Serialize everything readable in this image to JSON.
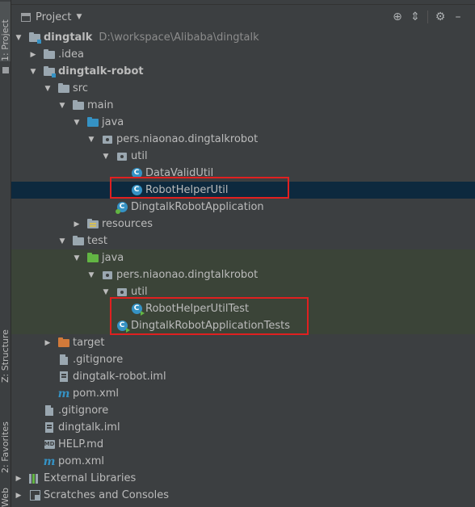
{
  "panel": {
    "title": "Project",
    "dropdown_glyph": "▼",
    "toolbar_icons": [
      "locate-icon",
      "collapse-all-icon",
      "gear-icon",
      "hide-icon"
    ]
  },
  "side_tabs": {
    "project": "1: Project",
    "structure": "Z: Structure",
    "favorites": "2: Favorites",
    "web": "Web"
  },
  "tree": [
    {
      "label": "dingtalk",
      "path": "D:\\workspace\\Alibaba\\dingtalk",
      "icon": "module-folder-icon",
      "expanded": true
    },
    {
      "label": ".idea",
      "icon": "folder-icon",
      "expanded": false
    },
    {
      "label": "dingtalk-robot",
      "icon": "module-folder-icon",
      "expanded": true
    },
    {
      "label": "src",
      "icon": "folder-icon",
      "expanded": true
    },
    {
      "label": "main",
      "icon": "folder-icon",
      "expanded": true
    },
    {
      "label": "java",
      "icon": "source-folder-icon",
      "expanded": true
    },
    {
      "label": "pers.niaonao.dingtalkrobot",
      "icon": "package-icon",
      "expanded": true
    },
    {
      "label": "util",
      "icon": "package-icon",
      "expanded": true
    },
    {
      "label": "DataValidUtil",
      "icon": "class-icon"
    },
    {
      "label": "RobotHelperUtil",
      "icon": "class-icon",
      "selected": true
    },
    {
      "label": "DingtalkRobotApplication",
      "icon": "spring-boot-class-icon"
    },
    {
      "label": "resources",
      "icon": "resources-folder-icon",
      "expanded": false
    },
    {
      "label": "test",
      "icon": "folder-icon",
      "expanded": true
    },
    {
      "label": "java",
      "icon": "test-source-folder-icon",
      "expanded": true
    },
    {
      "label": "pers.niaonao.dingtalkrobot",
      "icon": "package-icon",
      "expanded": true
    },
    {
      "label": "util",
      "icon": "package-icon",
      "expanded": true
    },
    {
      "label": "RobotHelperUtilTest",
      "icon": "test-class-icon"
    },
    {
      "label": "DingtalkRobotApplicationTests",
      "icon": "test-class-icon"
    },
    {
      "label": "target",
      "icon": "excluded-folder-icon",
      "expanded": false
    },
    {
      "label": ".gitignore",
      "icon": "file-icon"
    },
    {
      "label": "dingtalk-robot.iml",
      "icon": "iml-file-icon"
    },
    {
      "label": "pom.xml",
      "icon": "maven-icon"
    },
    {
      "label": ".gitignore",
      "icon": "file-icon"
    },
    {
      "label": "dingtalk.iml",
      "icon": "iml-file-icon"
    },
    {
      "label": "HELP.md",
      "icon": "markdown-icon",
      "icon_text": "MD"
    },
    {
      "label": "pom.xml",
      "icon": "maven-icon"
    },
    {
      "label": "External Libraries",
      "icon": "library-icon",
      "expanded": false
    },
    {
      "label": "Scratches and Consoles",
      "icon": "scratches-icon",
      "expanded": false
    }
  ],
  "colors": {
    "background": "#3c3f41",
    "selection": "#0d293e",
    "test_area": "#3b4438",
    "highlight_box": "#e02020",
    "source_folder": "#3592c4",
    "test_folder": "#62b543",
    "excluded_folder": "#d27a3a"
  }
}
